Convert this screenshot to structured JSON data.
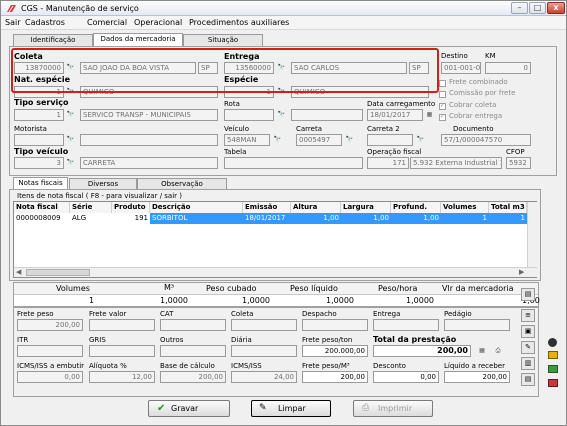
{
  "window": {
    "title": "CGS - Manutenção de serviço"
  },
  "menu": [
    "Sair",
    "Cadastros",
    "Comercial",
    "Operacional",
    "Procedimentos auxiliares"
  ],
  "tabs": [
    "Identificação",
    "Dados da mercadoria",
    "Situação"
  ],
  "coleta": {
    "label": "Coleta",
    "code": "13870000",
    "city": "SAO JOAO DA BOA VISTA",
    "uf": "SP"
  },
  "entrega": {
    "label": "Entrega",
    "code": "13560000",
    "city": "SAO CARLOS",
    "uf": "SP"
  },
  "destino": {
    "label": "Destino",
    "value": "001-001-001"
  },
  "km": {
    "label": "KM",
    "value": "0"
  },
  "nat_especie": {
    "label": "Nat. espécie",
    "code": "1",
    "value": "QUIMICO"
  },
  "especie": {
    "label": "Espécie",
    "code": "1",
    "value": "QUIMICO"
  },
  "tipo_servico": {
    "label": "Tipo serviço",
    "code": "1",
    "value": "SERVICO TRANSP - MUNICIPAIS"
  },
  "rota": {
    "label": "Rota"
  },
  "data_carregamento": {
    "label": "Data carregamento",
    "value": "18/01/2017"
  },
  "motorista": {
    "label": "Motorista"
  },
  "veiculo": {
    "label": "Veículo",
    "value": "548MAN"
  },
  "carreta": {
    "label": "Carreta",
    "value": "0005497"
  },
  "carreta2": {
    "label": "Carreta 2"
  },
  "documento": {
    "label": "Documento",
    "value": "57/1/000047570"
  },
  "tipo_veiculo": {
    "label": "Tipo veículo",
    "code": "3",
    "value": "CARRETA"
  },
  "tabela": {
    "label": "Tabela"
  },
  "operacao_fiscal": {
    "label": "Operação fiscal",
    "code": "171",
    "value": "5.932 Externa Industrial 12%"
  },
  "cfop": {
    "label": "CFOP",
    "value": "5932"
  },
  "checks": [
    {
      "label": "Frete combinado",
      "checked": false
    },
    {
      "label": "Comissão por frete",
      "checked": false
    },
    {
      "label": "Cobrar coleta",
      "checked": true
    },
    {
      "label": "Cobrar entrega",
      "checked": true
    }
  ],
  "subtabs": [
    "Notas fiscais",
    "Diversos",
    "Observação"
  ],
  "nf_group": "Itens de nota fiscal ( F8 - para visualizar / sair )",
  "nf_headers": [
    "Nota fiscal",
    "Série",
    "Produto",
    "Descrição",
    "Emissão",
    "Altura",
    "Largura",
    "Profund.",
    "Volumes",
    "Total m3"
  ],
  "nf_rows": [
    [
      "0000008009",
      "ALG",
      "191",
      "SORBITOL",
      "18/01/2017",
      "1,00",
      "1,00",
      "1,00",
      "1",
      "1"
    ]
  ],
  "summary": {
    "headers": [
      "Volumes",
      "M³",
      "Peso cubado",
      "Peso líquido",
      "Peso/hora",
      "Vlr da mercadoria"
    ],
    "values": [
      "1",
      "1,0000",
      "1,0000",
      "1,0000",
      "1,0000",
      "1,00"
    ]
  },
  "frete": {
    "r1": [
      [
        "Frete peso",
        "200,00"
      ],
      [
        "Frete valor",
        ""
      ],
      [
        "CAT",
        ""
      ],
      [
        "Coleta",
        ""
      ],
      [
        "Despacho",
        ""
      ],
      [
        "Entrega",
        ""
      ],
      [
        "Pedágio",
        ""
      ]
    ],
    "r2": [
      [
        "ITR",
        ""
      ],
      [
        "GRIS",
        ""
      ],
      [
        "Outros",
        ""
      ],
      [
        "Diária",
        ""
      ],
      [
        "Frete peso/ton",
        "200.000,00"
      ],
      [
        "Total da prestação",
        "200,00"
      ]
    ],
    "r3": [
      [
        "ICMS/ISS a embutir",
        "0,00"
      ],
      [
        "Alíquota %",
        "12,00"
      ],
      [
        "Base de cálculo",
        "200,00"
      ],
      [
        "ICMS/ISS",
        "24,00"
      ],
      [
        "Frete peso/M³",
        "200,00"
      ],
      [
        "Desconto",
        "0,00"
      ],
      [
        "Líquido a receber",
        "200,00"
      ]
    ]
  },
  "buttons": {
    "gravar": "Gravar",
    "limpar": "Limpar",
    "imprimir": "Imprimir"
  }
}
